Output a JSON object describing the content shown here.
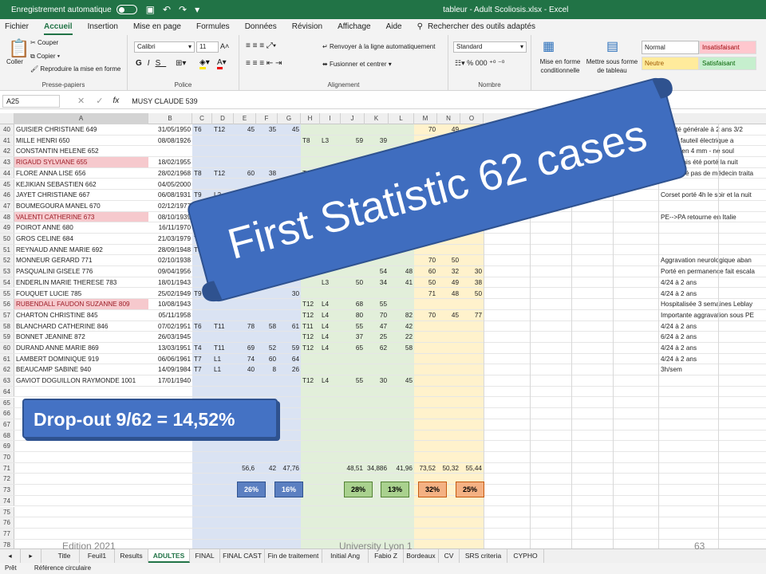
{
  "titlebar": {
    "autosave": "Enregistrement automatique",
    "title": "tableur - Adult Scoliosis.xlsx - Excel"
  },
  "menu": [
    "Fichier",
    "Accueil",
    "Insertion",
    "Mise en page",
    "Formules",
    "Données",
    "Révision",
    "Affichage",
    "Aide",
    "Rechercher des outils adaptés"
  ],
  "ribbon": {
    "paste": "Coller",
    "cut": "Couper",
    "copy": "Copier",
    "format_painter": "Reproduire la mise en forme",
    "clipboard": "Presse-papiers",
    "font_name": "Calibri",
    "font_size": "11",
    "font_group": "Police",
    "wrap": "Renvoyer à la ligne automatiquement",
    "merge": "Fusionner et centrer",
    "align_group": "Alignement",
    "number_format": "Standard",
    "number_group": "Nombre",
    "cond_format": "Mise en forme conditionnelle",
    "table_format": "Mettre sous forme de tableau",
    "style_normal": "Normal",
    "style_bad": "Insatisfaisant",
    "style_neutral": "Neutre",
    "style_good": "Satisfaisant"
  },
  "formula": {
    "cell": "A25",
    "value": "MUSY CLAUDE 539"
  },
  "columns": [
    "A",
    "B",
    "C",
    "D",
    "E",
    "F",
    "G",
    "H",
    "I",
    "J",
    "K",
    "L",
    "M",
    "N",
    "O"
  ],
  "rows": [
    {
      "n": "40",
      "a": "GUISIER CHRISTIANE 649",
      "b": "31/05/1950",
      "c": "T6",
      "d": "T12",
      "e": "45",
      "f": "35",
      "g": "45",
      "m": "70",
      "nn": "49",
      "notes": "gabilité générale à 2 ans 3/2"
    },
    {
      "n": "41",
      "a": "MILLE HENRI 650",
      "b": "08/08/1926",
      "h": "T8",
      "i": "L3",
      "j": "59",
      "k": "39",
      "m": "65",
      "notes": "féré le fauteil électrique a"
    },
    {
      "n": "42",
      "a": "CONSTANTIN HELENE 652",
      "notes": "réalisé en 4 mm - ne soul"
    },
    {
      "n": "43",
      "a": "RIGAUD SYLVIANE 655",
      "pink": true,
      "b": "18/02/1955",
      "notes": "N'a jamais été porté la nuit"
    },
    {
      "n": "44",
      "a": "FLORE ANNA LISE 656",
      "b": "28/02/1968",
      "c": "T8",
      "d": "T12",
      "e": "60",
      "f": "38",
      "h": "T12",
      "i": "L4",
      "j": "45",
      "k": "32",
      "notes": "C2 refusé pas de médecin traita"
    },
    {
      "n": "45",
      "a": "KEJIKIAN SEBASTIEN 662",
      "b": "04/05/2000"
    },
    {
      "n": "46",
      "a": "JAYET CHRISTIANE 667",
      "b": "06/08/1931",
      "c": "T9",
      "d": "L2",
      "e": "38",
      "f": "31",
      "g": "32",
      "notes": "Corset porté 4h le soir et la nuit"
    },
    {
      "n": "47",
      "a": "BOUMEGOURA MANEL 670",
      "b": "02/12/1977",
      "c": "T4",
      "d": "T12",
      "e": "31",
      "f": "29"
    },
    {
      "n": "48",
      "a": "VALENTI CATHERINE 673",
      "pink": true,
      "b": "08/10/1939",
      "notes": "PE-->PA retourne en Italie"
    },
    {
      "n": "49",
      "a": "POIROT ANNE 680",
      "b": "16/11/1970",
      "o": "31"
    },
    {
      "n": "50",
      "a": "GROS CELINE 684",
      "b": "21/03/1979",
      "c": "T"
    },
    {
      "n": "51",
      "a": "REYNAUD ANNE MARIE 692",
      "b": "28/09/1948",
      "c": "T8"
    },
    {
      "n": "52",
      "a": "MONNEUR GERARD 771",
      "b": "02/10/1938",
      "m": "70",
      "nn": "50",
      "notes": "Aggravation neurologique aban"
    },
    {
      "n": "53",
      "a": "PASQUALINI GISELE 776",
      "b": "09/04/1956",
      "k": "54",
      "l": "48",
      "m": "60",
      "nn": "32",
      "o": "30",
      "notes": "Porté en permanence fait escala"
    },
    {
      "n": "54",
      "a": "ENDERLIN MARIE THERESE 783",
      "b": "18/01/1943",
      "i": "L3",
      "j": "50",
      "k": "34",
      "l": "41",
      "m": "50",
      "nn": "49",
      "o": "38",
      "notes": "4/24 à 2 ans"
    },
    {
      "n": "55",
      "a": "FOUQUET LUCIE 785",
      "b": "25/02/1949",
      "c": "T9",
      "g": "30",
      "m": "71",
      "nn": "48",
      "o": "50",
      "notes": "4/24 à 2 ans"
    },
    {
      "n": "56",
      "a": "RUBENDALL FAUDON SUZANNE 809",
      "pink": true,
      "b": "10/08/1943",
      "h": "T12",
      "i": "L4",
      "j": "68",
      "k": "55",
      "notes": "Hospitalisée 3 semaines Leblay"
    },
    {
      "n": "57",
      "a": "CHARTON CHRISTINE 845",
      "b": "05/11/1958",
      "h": "T12",
      "i": "L4",
      "j": "80",
      "k": "70",
      "l": "82",
      "m": "70",
      "nn": "45",
      "o": "77",
      "notes": "Importante aggravation sous PE"
    },
    {
      "n": "58",
      "a": "BLANCHARD CATHERINE 846",
      "b": "07/02/1951",
      "c": "T6",
      "d": "T11",
      "e": "78",
      "f": "58",
      "g": "61",
      "h": "T11",
      "i": "L4",
      "j": "55",
      "k": "47",
      "l": "42",
      "notes": "4/24 à 2 ans"
    },
    {
      "n": "59",
      "a": "BONNET JEANINE 872",
      "b": "26/03/1945",
      "h": "T12",
      "i": "L4",
      "j": "37",
      "k": "25",
      "l": "22",
      "notes": "6/24 à 2 ans"
    },
    {
      "n": "60",
      "a": "DURAND ANNE MARIE 869",
      "b": "13/03/1951",
      "c": "T4",
      "d": "T11",
      "e": "69",
      "f": "52",
      "g": "59",
      "h": "T12",
      "i": "L4",
      "j": "65",
      "k": "62",
      "l": "58",
      "notes": "4/24 à 2 ans"
    },
    {
      "n": "61",
      "a": "LAMBERT DOMINIQUE 919",
      "b": "06/06/1961",
      "c": "T7",
      "d": "L1",
      "e": "74",
      "f": "60",
      "g": "64",
      "notes": "4/24 à 2 ans"
    },
    {
      "n": "62",
      "a": "BEAUCAMP SABINE 940",
      "b": "14/09/1984",
      "c": "T7",
      "d": "L1",
      "e": "40",
      "f": "8",
      "g": "26",
      "notes": "3h/sem"
    },
    {
      "n": "63",
      "a": "GAVIOT DOGUILLON RAYMONDE 1001",
      "b": "17/01/1940",
      "h": "T12",
      "i": "L4",
      "j": "55",
      "k": "30",
      "l": "45"
    },
    {
      "n": "64"
    },
    {
      "n": "65"
    },
    {
      "n": "66"
    },
    {
      "n": "67"
    },
    {
      "n": "68"
    },
    {
      "n": "69"
    },
    {
      "n": "70"
    },
    {
      "n": "71",
      "e": "56,6",
      "f": "42",
      "g": "47,76",
      "j": "48,51",
      "k": "34,886",
      "l": "41,96",
      "m": "73,52",
      "nn": "50,32",
      "o": "55,44"
    },
    {
      "n": "72"
    },
    {
      "n": "73"
    },
    {
      "n": "74"
    },
    {
      "n": "75"
    },
    {
      "n": "76"
    },
    {
      "n": "77"
    },
    {
      "n": "78"
    },
    {
      "n": "79"
    }
  ],
  "tags": [
    {
      "label": "26%",
      "color": "#5b7fc1",
      "border": "#2f528f",
      "text": "#fff"
    },
    {
      "label": "16%",
      "color": "#5b7fc1",
      "border": "#2f528f",
      "text": "#fff"
    },
    {
      "label": "28%",
      "color": "#a9d18e",
      "border": "#548235",
      "text": "#000"
    },
    {
      "label": "13%",
      "color": "#a9d18e",
      "border": "#548235",
      "text": "#000"
    },
    {
      "label": "32%",
      "color": "#f4b183",
      "border": "#c55a11",
      "text": "#000"
    },
    {
      "label": "25%",
      "color": "#f4b183",
      "border": "#c55a11",
      "text": "#000"
    }
  ],
  "sheets": [
    "Title",
    "Feuil1",
    "Results",
    "ADULTES",
    "FINAL",
    "FINAL CAST",
    "Fin de traitement",
    "Initial Ang",
    "Fabio Z",
    "Bordeaux",
    "CV",
    "SRS criteria",
    "CYPHO"
  ],
  "status": {
    "ready": "Prêt",
    "circular": "Référence circulaire"
  },
  "overlay": {
    "banner": "First Statistic 62 cases",
    "dropout": "Drop-out 9/62 = 14,52%"
  },
  "footer": {
    "left": "Edition 2021",
    "center": "University Lyon 1",
    "right": "63"
  }
}
